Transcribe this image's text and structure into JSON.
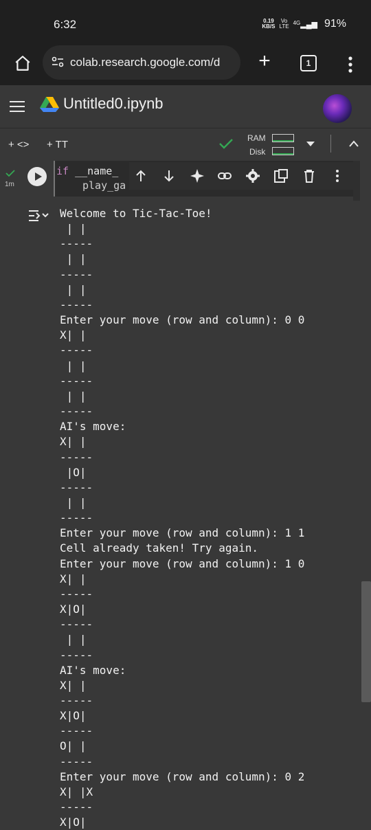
{
  "status_bar": {
    "time": "6:32",
    "net_speed_top": "0.19",
    "net_speed_bottom": "KB/S",
    "volte_top": "Vo",
    "volte_bottom": "LTE",
    "signal_label": "4G",
    "battery": "91%"
  },
  "browser": {
    "url": "colab.research.google.com/d",
    "tab_count": "1"
  },
  "colab": {
    "notebook_title": "Untitled0.ipynb",
    "toolbar": {
      "add_code_label": "+ <>",
      "add_text_label": "+ TT",
      "ram_label": "RAM",
      "disk_label": "Disk"
    },
    "cell": {
      "exec_time": "1m",
      "code_line1_kw": "if",
      "code_line1_rest": " __name_",
      "code_line2": "play_ga"
    },
    "output": "Welcome to Tic-Tac-Toe!\n | |\n-----\n | |\n-----\n | |\n-----\nEnter your move (row and column): 0 0\nX| |\n-----\n | |\n-----\n | |\n-----\nAI's move:\nX| |\n-----\n |O|\n-----\n | |\n-----\nEnter your move (row and column): 1 1\nCell already taken! Try again.\nEnter your move (row and column): 1 0\nX| |\n-----\nX|O|\n-----\n | |\n-----\nAI's move:\nX| |\n-----\nX|O|\n-----\nO| |\n-----\nEnter your move (row and column): 0 2\nX| |X\n-----\nX|O|"
  },
  "colors": {
    "background": "#383838",
    "statusbar_bg": "#1f1f1f",
    "accent_green": "#34a853",
    "keyword_purple": "#c586c0"
  },
  "icons": [
    "home-icon",
    "tune-icon",
    "plus-icon",
    "tabs-icon",
    "kebab-icon",
    "menu-icon",
    "drive-icon",
    "check-icon",
    "caret-down-icon",
    "chevron-up-icon",
    "run-icon",
    "arrow-up-icon",
    "arrow-down-icon",
    "sparkle-icon",
    "link-icon",
    "gear-icon",
    "mirror-icon",
    "trash-icon",
    "more-icon",
    "output-icon"
  ]
}
